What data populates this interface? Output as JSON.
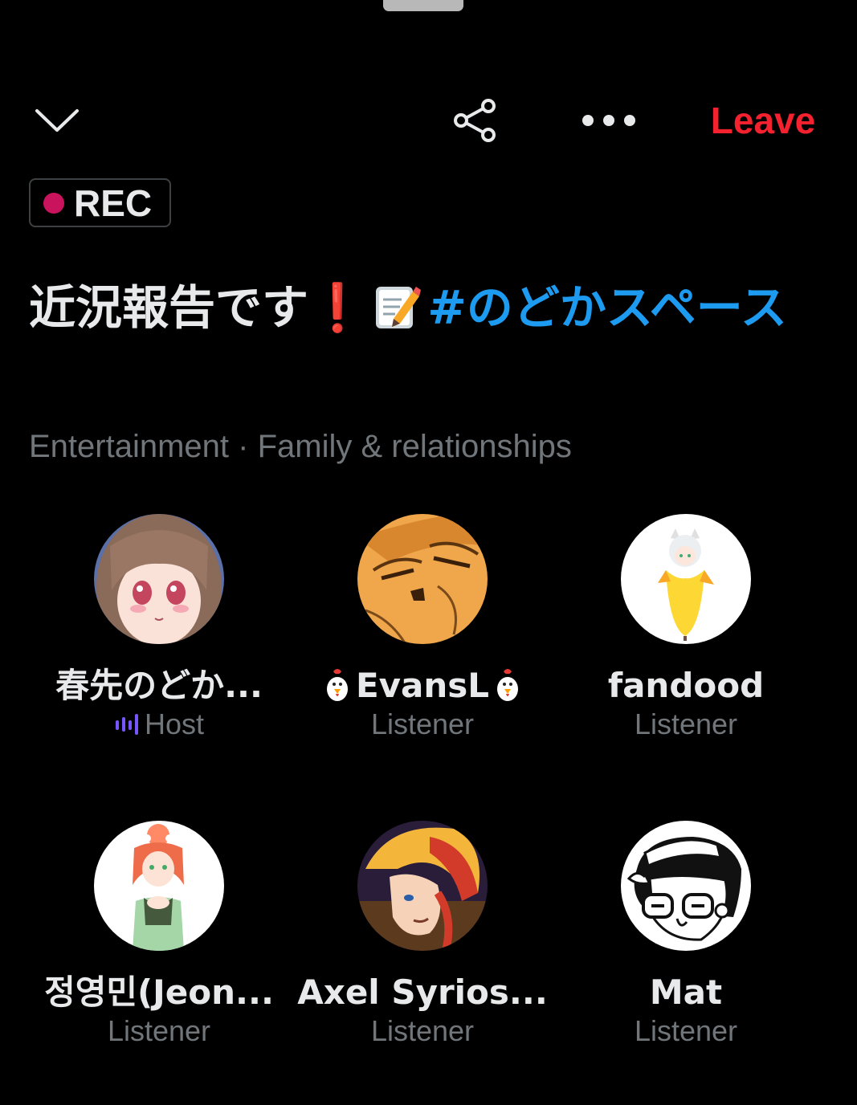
{
  "header": {
    "leave_label": "Leave",
    "icons": [
      "chevron-down-icon",
      "share-icon",
      "more-icon"
    ]
  },
  "space": {
    "rec_label": "REC",
    "title_text": "近況報告です",
    "title_hashtag": "#のどかスペース",
    "topics": "Entertainment · Family & relationships"
  },
  "participants": [
    {
      "name": "春先のどか...",
      "role": "Host"
    },
    {
      "name": "EvansL",
      "role": "Listener"
    },
    {
      "name": "fandood",
      "role": "Listener"
    },
    {
      "name": "정영민(Jeon...",
      "role": "Listener"
    },
    {
      "name": "Axel Syrios...",
      "role": "Listener"
    },
    {
      "name": "Mat",
      "role": "Listener"
    }
  ],
  "colors": {
    "background": "#000000",
    "leave": "#f4212e",
    "hashtag": "#1d9bf0",
    "rec_dot": "#c9135d",
    "secondary_text": "#71767b",
    "host_wave": "#7856ff"
  }
}
